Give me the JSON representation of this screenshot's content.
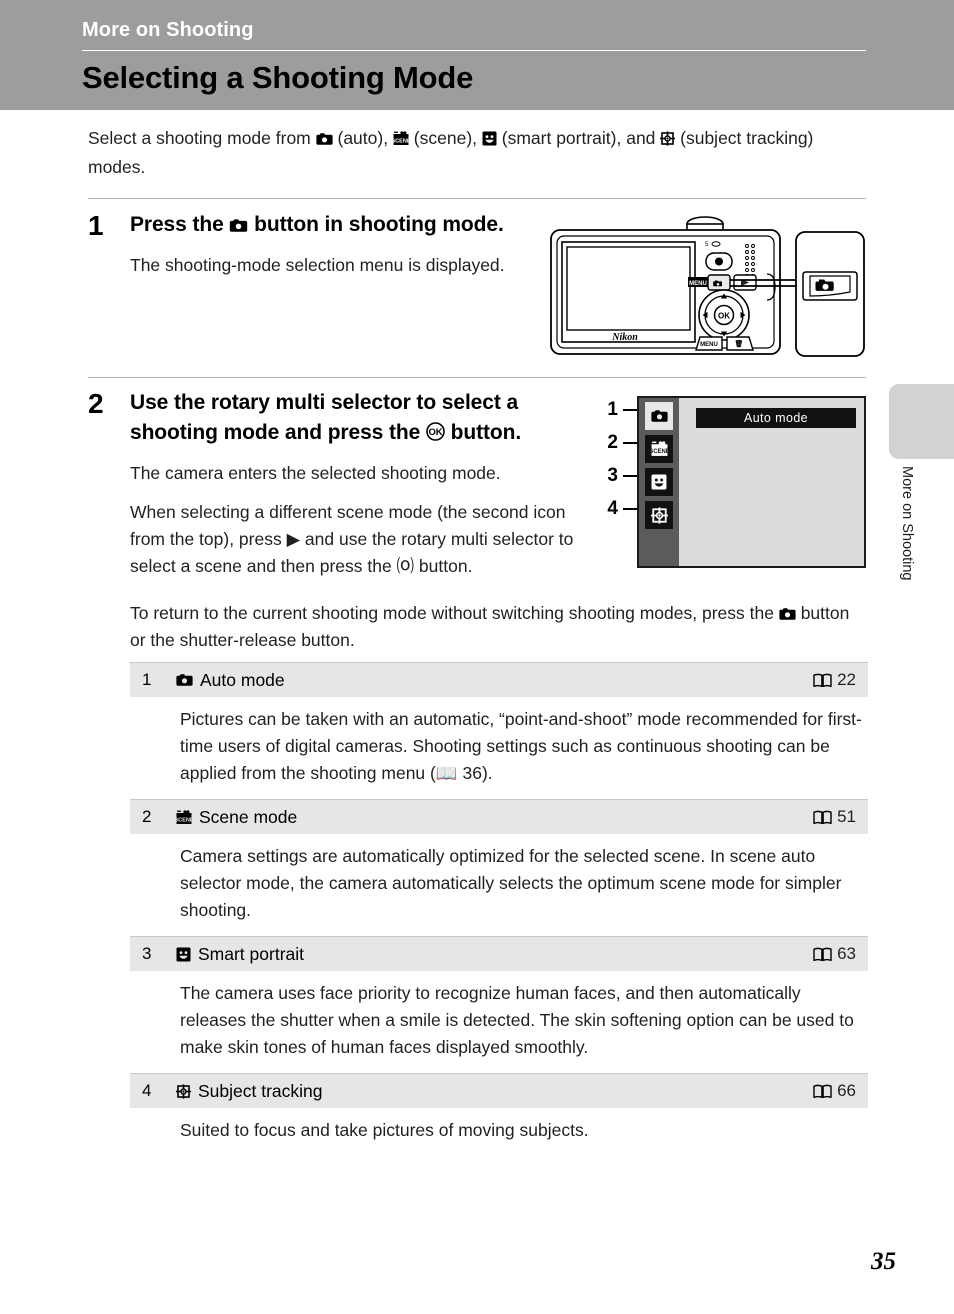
{
  "header": {
    "kicker": "More on Shooting",
    "title": "Selecting a Shooting Mode"
  },
  "intro": {
    "prefix": "Select a shooting mode from ",
    "auto_label": " (auto), ",
    "scene_label": " (scene), ",
    "smart_label": " (smart portrait), and ",
    "tracking_label": " (subject tracking) modes."
  },
  "steps": [
    {
      "number": "1",
      "head_before": "Press the ",
      "head_after": " button in shooting mode.",
      "paras": [
        "The shooting-mode selection menu is displayed."
      ]
    },
    {
      "number": "2",
      "head_before": "Use the rotary multi selector to select a shooting mode and press the ",
      "head_after": " button.",
      "paras": [
        "The camera enters the selected shooting mode.",
        "When selecting a different scene mode (the second icon from the top), press ▶ and use the rotary multi selector to select a scene and then press the ⒪ button."
      ]
    }
  ],
  "note": {
    "part1": "To return to the current shooting mode without switching shooting modes, press the ",
    "part2": " button or the shutter-release button."
  },
  "camera_illustration": {
    "brand": "Nikon",
    "ok_label": "OK",
    "menu_label": "MENU"
  },
  "menu_illustration": {
    "title": "Auto mode",
    "callouts": [
      "1",
      "2",
      "3",
      "4"
    ],
    "icons": [
      "camera-icon",
      "scene-icon",
      "smile-icon",
      "target-icon"
    ],
    "colors": {
      "rail": "#5b5b5b",
      "screen": "#dcdcdc",
      "title_bar": "#111111",
      "selected_tile": "#e8e8e8"
    }
  },
  "table": {
    "rows": [
      {
        "index": "1",
        "icon": "camera-icon",
        "label": "Auto mode",
        "page": "22",
        "description": "Pictures can be taken with an automatic, “point-and-shoot” mode recommended for first-time users of digital cameras. Shooting settings such as continuous shooting can be applied from the shooting menu (📖 36)."
      },
      {
        "index": "2",
        "icon": "scene-icon",
        "label": "Scene mode",
        "page": "51",
        "description": "Camera settings are automatically optimized for the selected scene. In scene auto selector mode, the camera automatically selects the optimum scene mode for simpler shooting."
      },
      {
        "index": "3",
        "icon": "smile-icon",
        "label": "Smart portrait",
        "page": "63",
        "description": "The camera uses face priority to recognize human faces, and then automatically releases the shutter when a smile is detected. The skin softening option can be used to make skin tones of human faces displayed smoothly."
      },
      {
        "index": "4",
        "icon": "target-icon",
        "label": "Subject tracking",
        "page": "66",
        "description": "Suited to focus and take pictures of moving subjects."
      }
    ]
  },
  "side_tab": {
    "label": "More on Shooting"
  },
  "page_number": "35",
  "colors": {
    "header_band": "#9d9d9d",
    "row_header": "#e6e6e6",
    "rule": "#b4b4b4"
  }
}
